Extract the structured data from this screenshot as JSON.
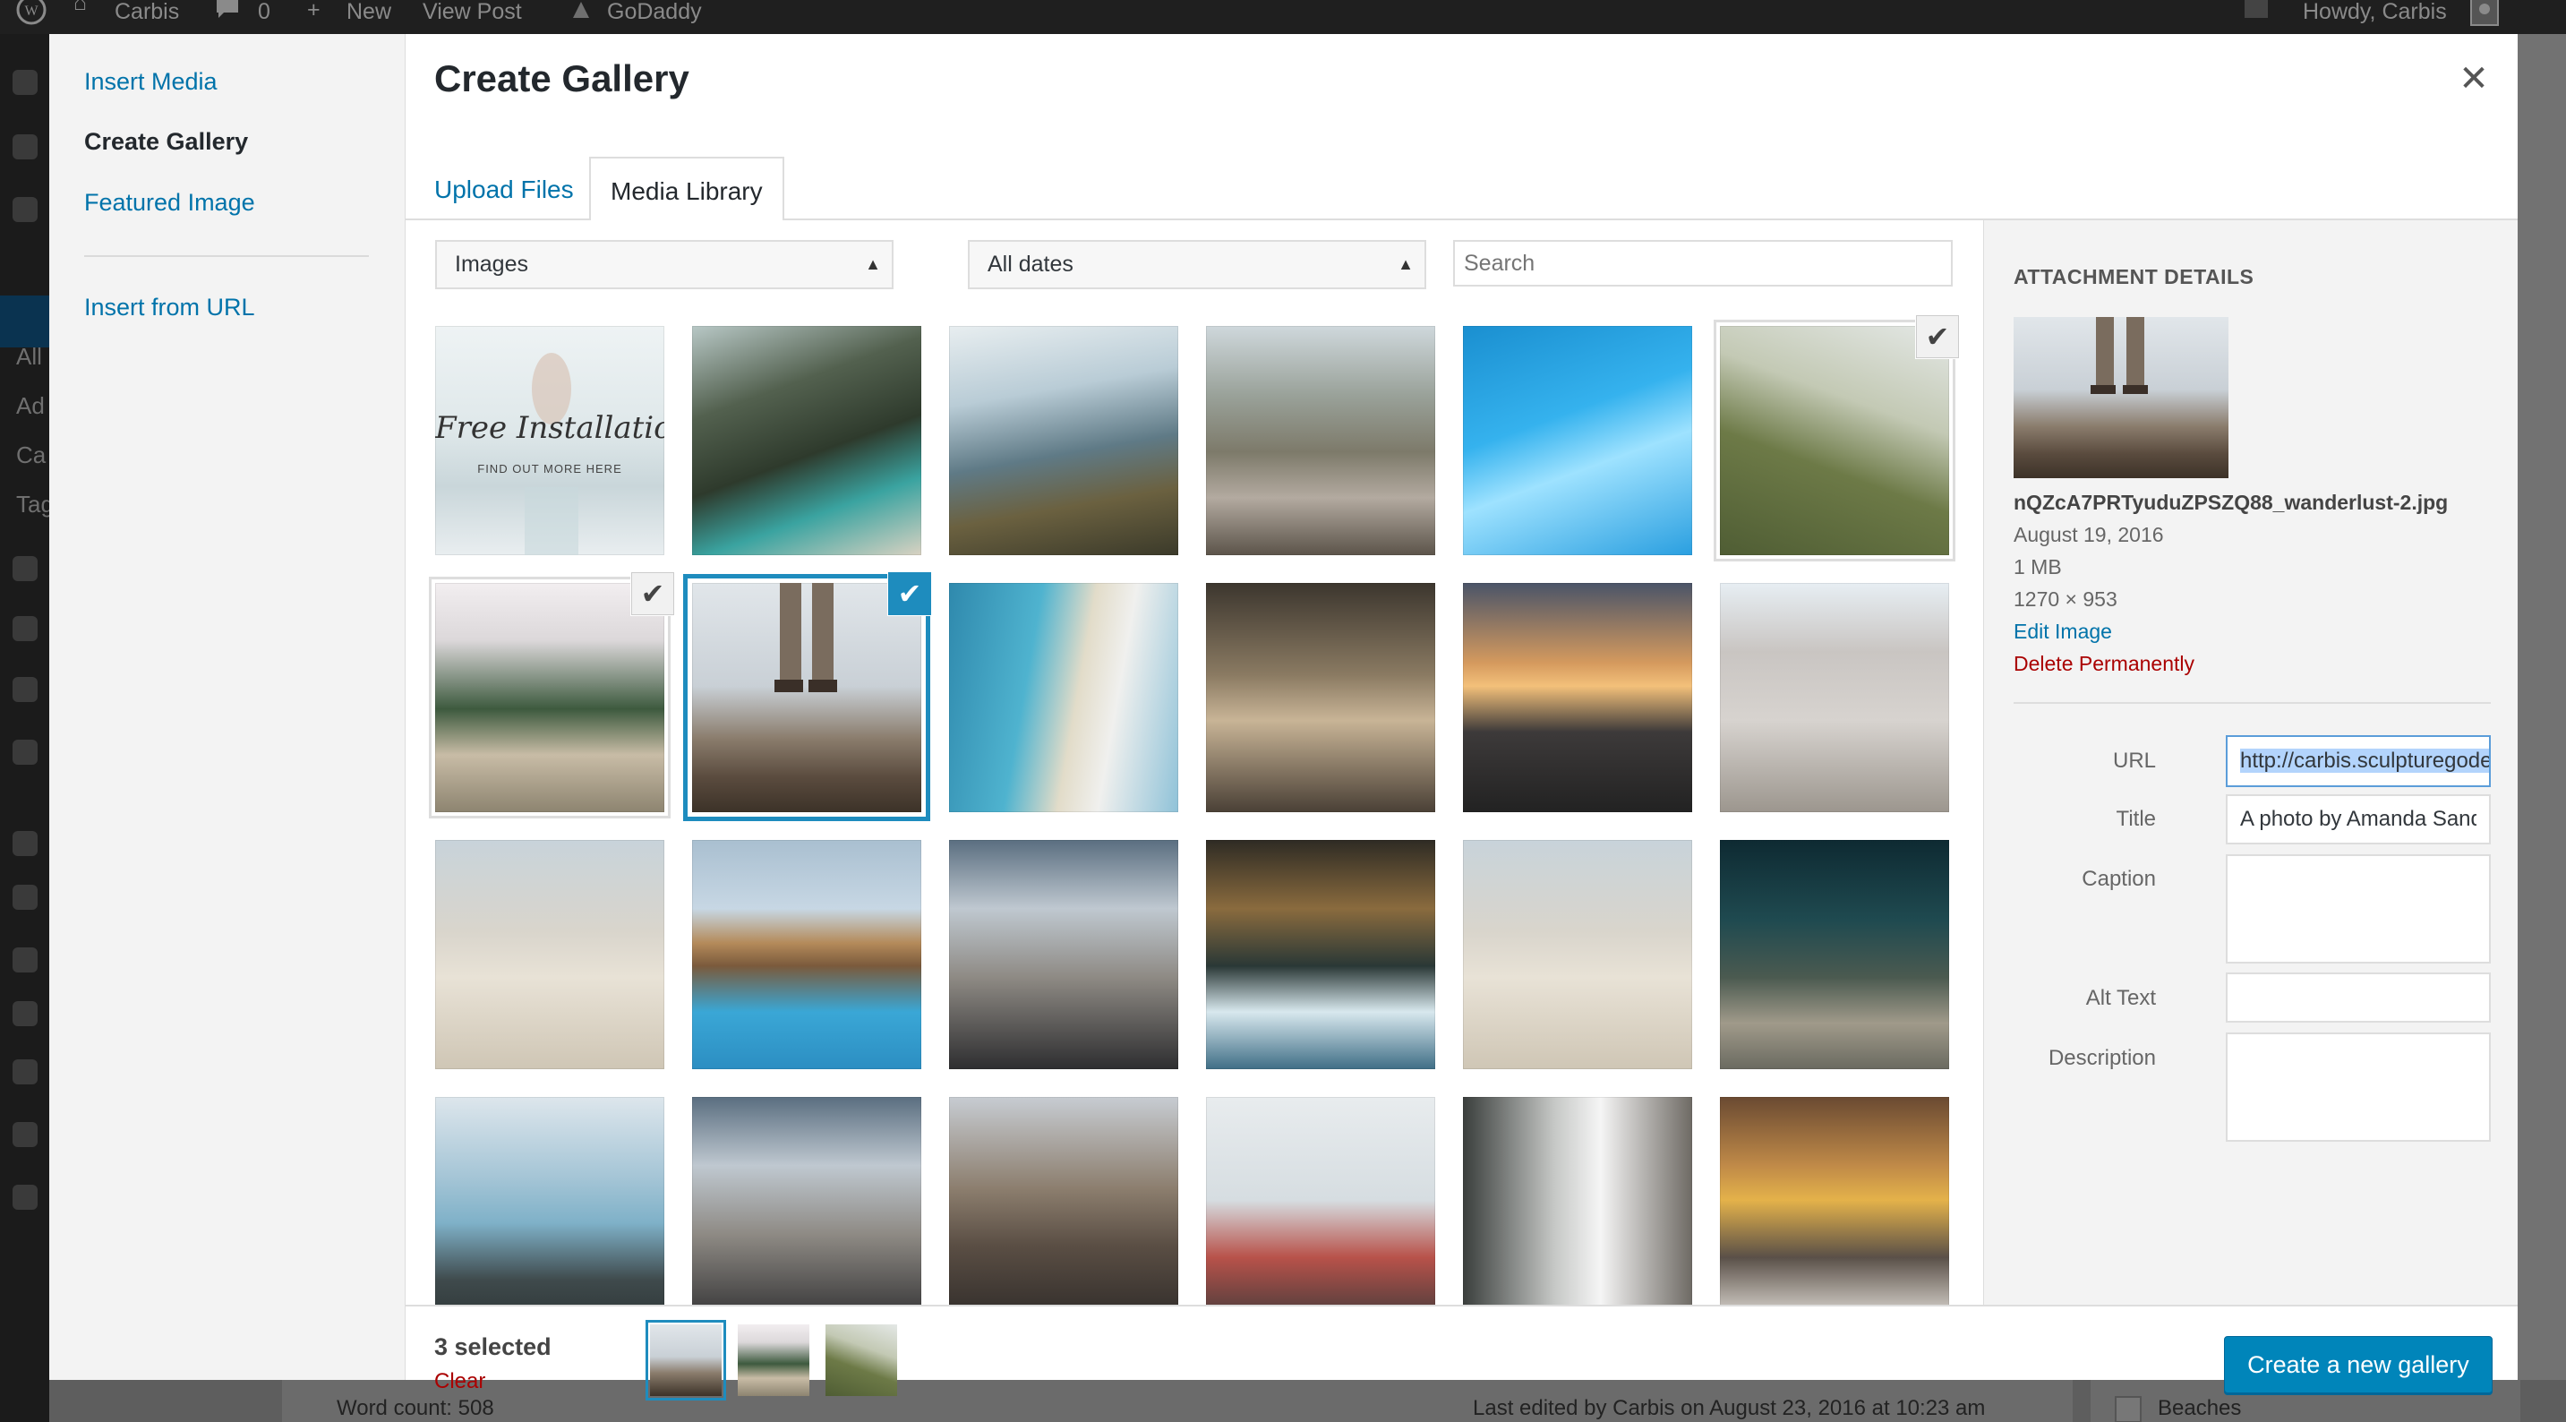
{
  "admin_bar": {
    "site_name": "Carbis",
    "comments_count": "0",
    "new_label": "New",
    "view_post_label": "View Post",
    "godaddy_label": "GoDaddy",
    "howdy": "Howdy, Carbis"
  },
  "admin_sidebar_fragments": [
    "All",
    "Ad",
    "Ca",
    "Tag"
  ],
  "background": {
    "word_count": "Word count: 508",
    "last_edited": "Last edited by Carbis on August 23, 2016 at 10:23 am",
    "category_label": "Beaches"
  },
  "modal": {
    "title": "Create Gallery",
    "close_glyph": "✕",
    "menu": {
      "insert_media": "Insert Media",
      "create_gallery": "Create Gallery",
      "featured_image": "Featured Image",
      "insert_from_url": "Insert from URL"
    },
    "tabs": {
      "upload_files": "Upload Files",
      "media_library": "Media Library"
    },
    "filters": {
      "type": "Images",
      "date": "All dates",
      "search_placeholder": "Search"
    },
    "grid_overlay": {
      "title": "Free Installation",
      "subtitle": "FIND OUT MORE HERE"
    },
    "check_glyph": "✔"
  },
  "attachment": {
    "heading": "ATTACHMENT DETAILS",
    "filename": "nQZcA7PRTyuduZPSZQ88_wanderlust-2.jpg",
    "date": "August 19, 2016",
    "size": "1 MB",
    "dimensions": "1270 × 953",
    "edit_link": "Edit Image",
    "delete_link": "Delete Permanently",
    "labels": {
      "url": "URL",
      "title": "Title",
      "caption": "Caption",
      "alt": "Alt Text",
      "description": "Description"
    },
    "url_value": "http://carbis.sculpturegode",
    "title_value": "A photo by Amanda Sandlin",
    "caption_value": "",
    "alt_value": "",
    "description_value": ""
  },
  "toolbar": {
    "selected_count": "3 selected",
    "clear": "Clear",
    "create_button": "Create a new gallery"
  },
  "colors": {
    "link": "#0073aa",
    "primary": "#0085ba",
    "selection": "#1e8cbe",
    "danger": "#a00000"
  }
}
